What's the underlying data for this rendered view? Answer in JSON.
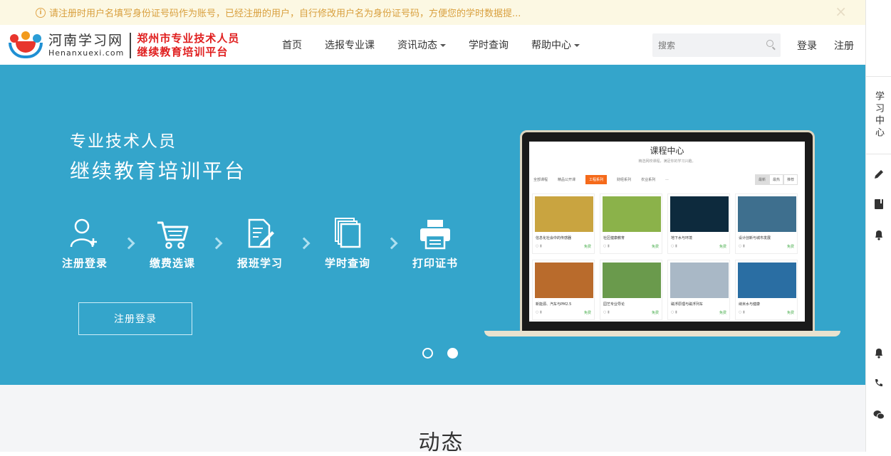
{
  "notice": {
    "icon": "info-icon",
    "text": "请注册时用户名填写身份证号码作为账号，已经注册的用户，自行修改用户名为身份证号码，方便您的学时数据提...",
    "close": "×"
  },
  "logo": {
    "cn": "河南学习网",
    "en": "Henanxuexi.com",
    "sub_line1": "郑州市专业技术人员",
    "sub_line2": "继续教育培训平台"
  },
  "nav": {
    "items": [
      {
        "label": "首页"
      },
      {
        "label": "选报专业课"
      },
      {
        "label": "资讯动态"
      },
      {
        "label": "学时查询"
      },
      {
        "label": "帮助中心"
      }
    ]
  },
  "search": {
    "placeholder": "搜索"
  },
  "auth": {
    "login": "登录",
    "register": "注册"
  },
  "banner": {
    "title1": "专业技术人员",
    "title2": "继续教育培训平台",
    "steps": [
      {
        "label": "注册登录",
        "icon": "user-add-icon"
      },
      {
        "label": "缴费选课",
        "icon": "cart-icon"
      },
      {
        "label": "报班学习",
        "icon": "edit-document-icon"
      },
      {
        "label": "学时查询",
        "icon": "stacked-pages-icon"
      },
      {
        "label": "打印证书",
        "icon": "printer-icon"
      }
    ],
    "button": "注册登录",
    "slides": 2,
    "active_slide": 2
  },
  "laptop_screen": {
    "title": "课程中心",
    "subtitle": "精选网校课程，满足你的学习兴趣。",
    "filters": [
      "全部课程",
      "精品公开课",
      "工程系列",
      "财经系列",
      "农业系列",
      "..."
    ],
    "active_filter": "工程系列",
    "sorts": [
      "最新",
      "最热",
      "推荐"
    ],
    "cards": [
      {
        "name": "信息化社会中的传感器",
        "free": "免费"
      },
      {
        "name": "社区健康教育",
        "free": "免费"
      },
      {
        "name": "地下水与环境",
        "free": "免费"
      },
      {
        "name": "设计创新与城市发展",
        "free": "免费"
      },
      {
        "name": "新能源、汽车与PM2.5",
        "free": "免费"
      },
      {
        "name": "园艺专业导论",
        "free": "免费"
      },
      {
        "name": "磁浮原理与磁浮列车",
        "free": "免费"
      },
      {
        "name": "纳米水与健康",
        "free": "免费"
      }
    ],
    "card_colors": [
      "#c9a440",
      "#8bb24a",
      "#0d2a3d",
      "#3e6f8e",
      "#b96b2c",
      "#6a9a4c",
      "#a9b8c6",
      "#2a6ea3"
    ]
  },
  "section": {
    "heading": "动态"
  },
  "sidebar": {
    "study_center": "学习中心",
    "icons": [
      "pencil-icon",
      "book-icon",
      "bell-icon",
      "bell-icon",
      "phone-icon",
      "wechat-icon"
    ]
  },
  "colors": {
    "banner": "#34a5cb",
    "notice_text": "#d9a03f",
    "logo_red": "#e02020"
  }
}
